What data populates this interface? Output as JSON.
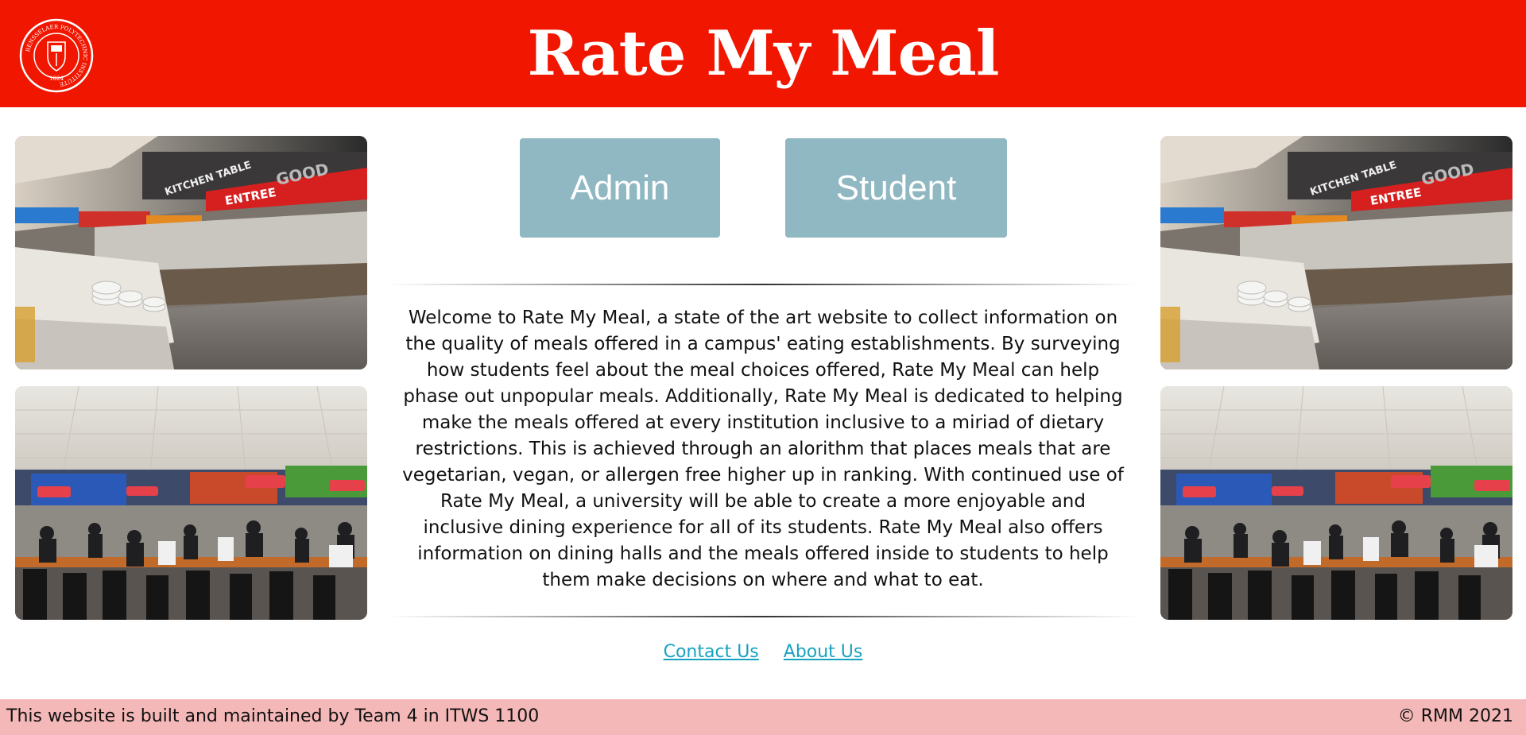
{
  "header": {
    "title": "Rate My Meal",
    "seal": {
      "ring_text": "RENSSELAER POLYTECHNIC INSTITUTE",
      "year": "1824",
      "icon": "institution-seal"
    }
  },
  "buttons": {
    "admin_label": "Admin",
    "student_label": "Student"
  },
  "welcome": {
    "text": "Welcome to Rate My Meal, a state of the art website to collect information on the quality of meals offered in a campus' eating establishments. By surveying how students feel about the meal choices offered, Rate My Meal can help phase out unpopular meals. Additionally, Rate My Meal is dedicated to helping make the meals offered at every institution inclusive to a miriad of dietary restrictions. This is achieved through an alorithm that places meals that are vegetarian, vegan, or allergen free higher up in ranking. With continued use of Rate My Meal, a university will be able to create a more enjoyable and inclusive dining experience for all of its students. Rate My Meal also offers information on dining halls and the meals offered inside to students to help them make decisions on where and what to eat."
  },
  "photos": {
    "servery_sign_1": "KITCHEN TABLE",
    "servery_sign_2": "GOOD",
    "servery_sign_3": "ENTREE"
  },
  "links": {
    "contact": "Contact Us",
    "about": "About Us"
  },
  "footer": {
    "left": "This website is built and maintained by Team 4 in ITWS 1100",
    "right": "© RMM 2021"
  },
  "colors": {
    "header_bg": "#f01600",
    "button_bg": "#8fb8c2",
    "link": "#17a2c2",
    "footer_bg": "#f5b8b8"
  }
}
